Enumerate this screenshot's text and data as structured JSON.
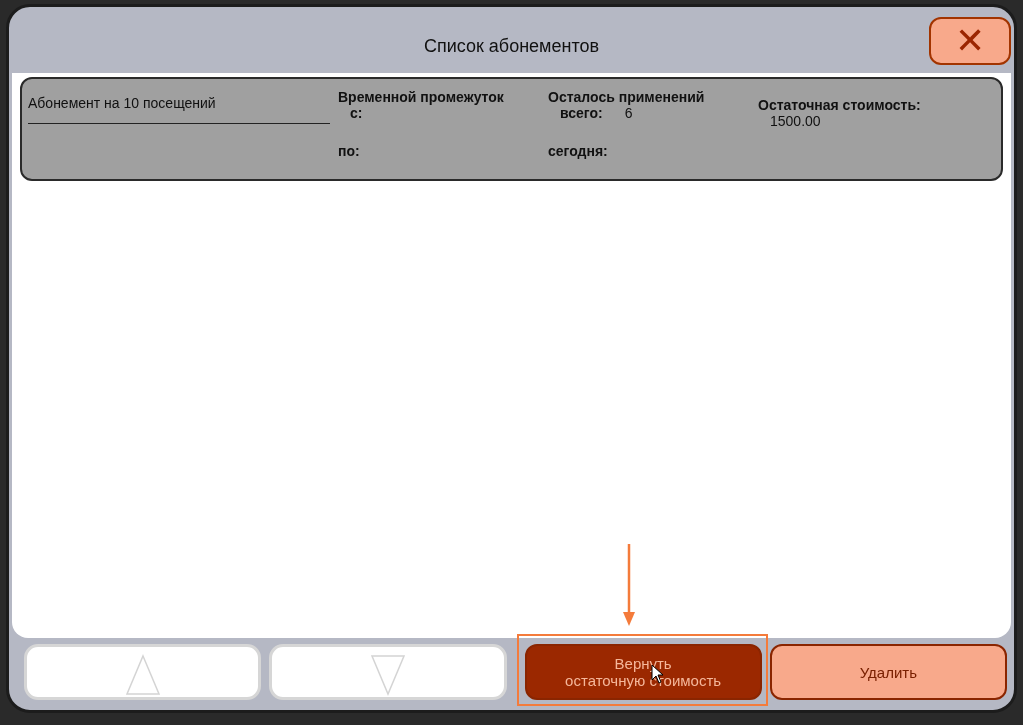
{
  "window": {
    "title": "Список абонементов",
    "close_label": "✕"
  },
  "subscriptions": [
    {
      "name": "Абонемент на 10 посещений",
      "period_label": "Временной промежуток",
      "from_label": "с:",
      "to_label": "по:",
      "uses_label": "Осталось применений",
      "total_label": "всего:",
      "total_value": "6",
      "today_label": "сегодня:",
      "cost_label": "Остаточная стоимость:",
      "cost_value": "1500.00"
    }
  ],
  "buttons": [
    {
      "kind": "up",
      "disabled": true
    },
    {
      "kind": "down",
      "disabled": true
    },
    {
      "kind": "text",
      "label_lines": [
        "Вернуть",
        "остаточную стоимость"
      ],
      "selected": true,
      "highlighted": true
    },
    {
      "kind": "text",
      "label_lines": [
        "Удалить"
      ],
      "selected": false,
      "highlighted": false
    }
  ]
}
